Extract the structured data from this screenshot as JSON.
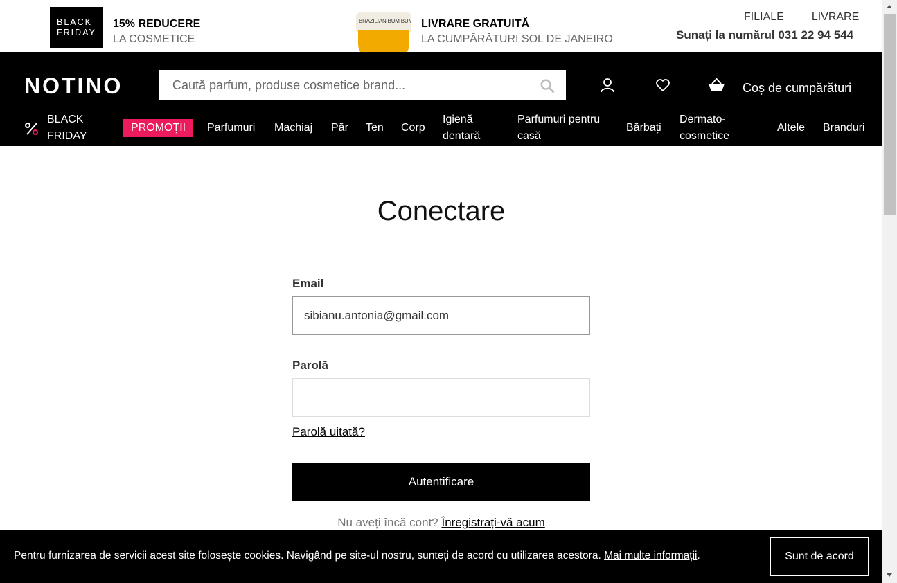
{
  "promo_bar": {
    "badge_line1": "BLACK",
    "badge_line2": "FRIDAY",
    "promo1_title": "15% REDUCERE",
    "promo1_sub": "LA COSMETICE",
    "jar_label": "BRAZILIAN BUM BUM CREAM",
    "promo2_title": "LIVRARE GRATUITĂ",
    "promo2_sub": "LA CUMPĂRĂTURI SOL DE JANEIRO",
    "link_filiale": "FILIALE",
    "link_livrare": "LIVRARE",
    "phone": "Sunați la numărul 031 22 94 544"
  },
  "header": {
    "logo": "NOTINO",
    "search_placeholder": "Caută parfum, produse cosmetice brand...",
    "cart_label": "Coș de cumpărături",
    "icons": [
      "search-icon",
      "user-icon",
      "heart-icon",
      "basket-icon",
      "percent-icon"
    ]
  },
  "nav": {
    "black_friday_1": "BLACK",
    "black_friday_2": "FRIDAY",
    "promotii": "PROMOȚII",
    "parfumuri": "Parfumuri",
    "machiaj": "Machiaj",
    "par": "Păr",
    "ten": "Ten",
    "corp": "Corp",
    "igiena_1": "Igienă",
    "igiena_2": "dentară",
    "parfumuri_casa_1": "Parfumuri pentru",
    "parfumuri_casa_2": "casă",
    "barbati": "Bărbați",
    "dermato_1": "Dermato-",
    "dermato_2": "cosmetice",
    "altele": "Altele",
    "branduri": "Branduri"
  },
  "login": {
    "title": "Conectare",
    "email_label": "Email",
    "email_value": "sibianu.antonia@gmail.com",
    "password_label": "Parolă",
    "password_value": "",
    "forgot": "Parolă uitată?",
    "submit": "Autentificare",
    "no_account": "Nu aveți încă cont?",
    "register": "Înregistrați-vă acum"
  },
  "cookie": {
    "text": "Pentru furnizarea de servicii acest site folosește cookies. Navigând pe site-ul nostru, sunteți de acord cu utilizarea acestora.",
    "link": "Mai multe informații",
    "suffix": ".",
    "accept": "Sunt de acord"
  },
  "colors": {
    "accent": "#ec1c5c",
    "header_bg": "#000000"
  }
}
